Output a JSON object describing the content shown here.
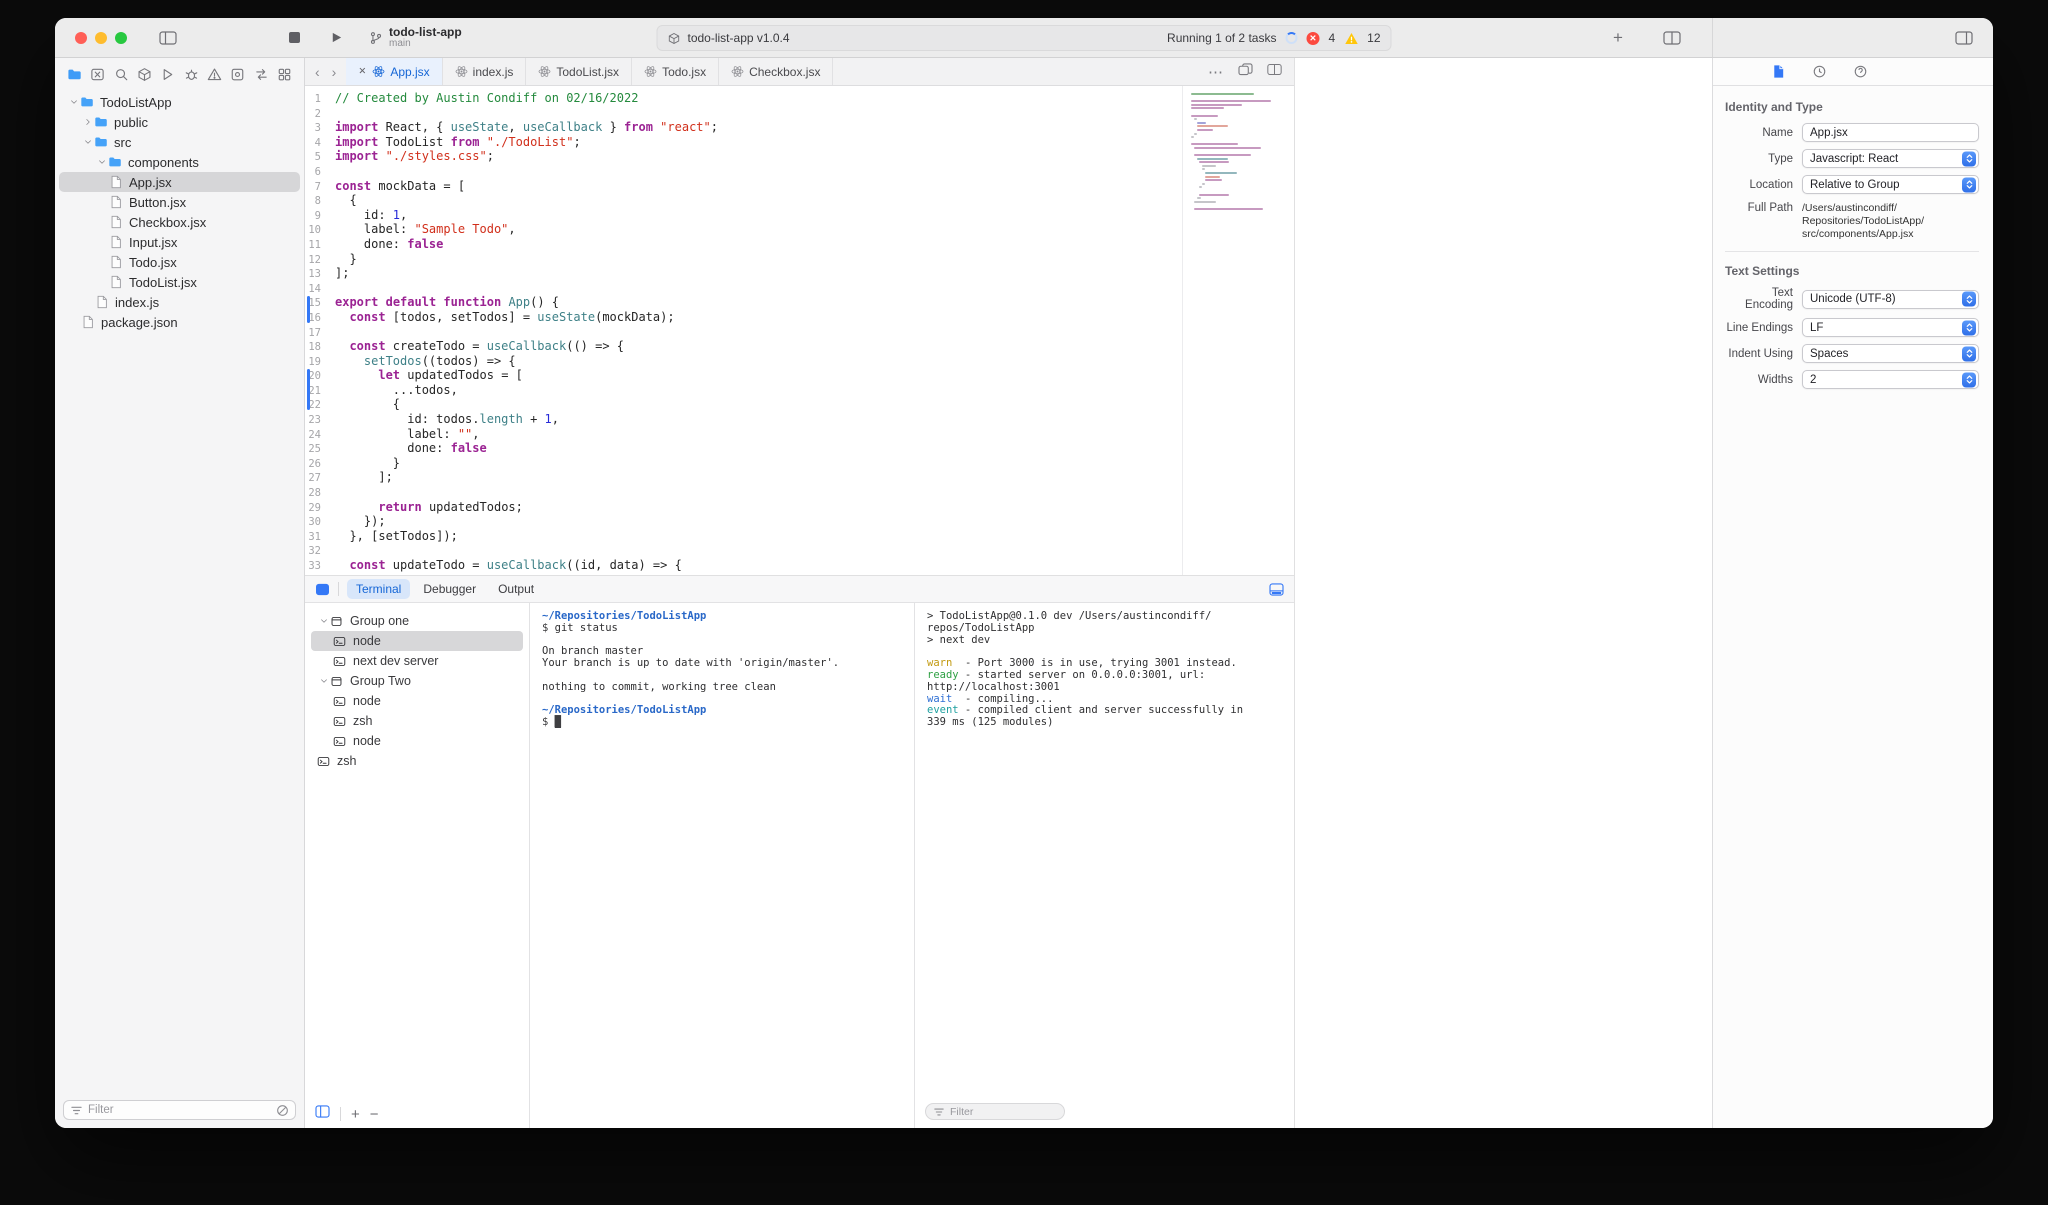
{
  "colors": {
    "accent": "#3478F6",
    "error": "#FF3B30",
    "warning": "#FFC60A",
    "syntax": {
      "comment": "#248A3D",
      "keyword": "#9B2393",
      "string": "#D12F1B",
      "number": "#272AD8",
      "function": "#3E8087",
      "plain": "#262626"
    },
    "terminal": {
      "path": "#2968C8",
      "warn": "#C29A10",
      "ready": "#2EA043",
      "wait": "#2E6FD4",
      "event": "#1FA0A0"
    }
  },
  "toolbar": {
    "project_name": "todo-list-app",
    "branch": "main",
    "status": {
      "package_label": "todo-list-app v1.0.4",
      "running_label": "Running 1 of 2 tasks",
      "errors": "4",
      "warnings": "12"
    }
  },
  "sidebar": {
    "active_nav_index": 0,
    "nav_icons": [
      "project-navigator",
      "version-control-navigator",
      "find-navigator",
      "package-navigator",
      "run-navigator",
      "debug-navigator",
      "issue-navigator",
      "test-navigator",
      "extension-navigator",
      "layout-navigator"
    ],
    "tree": [
      {
        "label": "TodoListApp",
        "level": 0,
        "type": "folder",
        "expanded": true
      },
      {
        "label": "public",
        "level": 1,
        "type": "folder",
        "expanded": false
      },
      {
        "label": "src",
        "level": 1,
        "type": "folder",
        "expanded": true
      },
      {
        "label": "components",
        "level": 2,
        "type": "folder",
        "expanded": true
      },
      {
        "label": "App.jsx",
        "level": 3,
        "type": "file",
        "selected": true
      },
      {
        "label": "Button.jsx",
        "level": 3,
        "type": "file"
      },
      {
        "label": "Checkbox.jsx",
        "level": 3,
        "type": "file"
      },
      {
        "label": "Input.jsx",
        "level": 3,
        "type": "file"
      },
      {
        "label": "Todo.jsx",
        "level": 3,
        "type": "file"
      },
      {
        "label": "TodoList.jsx",
        "level": 3,
        "type": "file"
      },
      {
        "label": "index.js",
        "level": 2,
        "type": "file"
      },
      {
        "label": "package.json",
        "level": 1,
        "type": "file"
      }
    ],
    "filter_placeholder": "Filter"
  },
  "tabs": {
    "items": [
      {
        "label": "App.jsx",
        "active": true
      },
      {
        "label": "index.js"
      },
      {
        "label": "TodoList.jsx"
      },
      {
        "label": "Todo.jsx"
      },
      {
        "label": "Checkbox.jsx"
      }
    ]
  },
  "editor": {
    "change_bars": [
      {
        "start": 15,
        "end": 16
      },
      {
        "start": 20,
        "end": 22
      }
    ],
    "lines": [
      [
        [
          "c",
          "// Created by Austin Condiff on 02/16/2022"
        ]
      ],
      [],
      [
        [
          "k",
          "import"
        ],
        [
          "p",
          " React, { "
        ],
        [
          "f",
          "useState"
        ],
        [
          "p",
          ", "
        ],
        [
          "f",
          "useCallback"
        ],
        [
          "p",
          " } "
        ],
        [
          "k",
          "from"
        ],
        [
          "p",
          " "
        ],
        [
          "s",
          "\"react\""
        ],
        [
          "p",
          ";"
        ]
      ],
      [
        [
          "k",
          "import"
        ],
        [
          "p",
          " TodoList "
        ],
        [
          "k",
          "from"
        ],
        [
          "p",
          " "
        ],
        [
          "s",
          "\"./TodoList\""
        ],
        [
          "p",
          ";"
        ]
      ],
      [
        [
          "k",
          "import"
        ],
        [
          "p",
          " "
        ],
        [
          "s",
          "\"./styles.css\""
        ],
        [
          "p",
          ";"
        ]
      ],
      [],
      [
        [
          "k",
          "const"
        ],
        [
          "p",
          " mockData = ["
        ]
      ],
      [
        [
          "p",
          "  {"
        ]
      ],
      [
        [
          "p",
          "    id: "
        ],
        [
          "n",
          "1"
        ],
        [
          "p",
          ","
        ]
      ],
      [
        [
          "p",
          "    label: "
        ],
        [
          "s",
          "\"Sample Todo\""
        ],
        [
          "p",
          ","
        ]
      ],
      [
        [
          "p",
          "    done: "
        ],
        [
          "k",
          "false"
        ]
      ],
      [
        [
          "p",
          "  }"
        ]
      ],
      [
        [
          "p",
          "];"
        ]
      ],
      [],
      [
        [
          "k",
          "export"
        ],
        [
          "p",
          " "
        ],
        [
          "k",
          "default"
        ],
        [
          "p",
          " "
        ],
        [
          "k",
          "function"
        ],
        [
          "p",
          " "
        ],
        [
          "f",
          "App"
        ],
        [
          "p",
          "() {"
        ]
      ],
      [
        [
          "p",
          "  "
        ],
        [
          "k",
          "const"
        ],
        [
          "p",
          " [todos, setTodos] = "
        ],
        [
          "f",
          "useState"
        ],
        [
          "p",
          "(mockData);"
        ]
      ],
      [],
      [
        [
          "p",
          "  "
        ],
        [
          "k",
          "const"
        ],
        [
          "p",
          " createTodo = "
        ],
        [
          "f",
          "useCallback"
        ],
        [
          "p",
          "(() => {"
        ]
      ],
      [
        [
          "p",
          "    "
        ],
        [
          "f",
          "setTodos"
        ],
        [
          "p",
          "((todos) => {"
        ]
      ],
      [
        [
          "p",
          "      "
        ],
        [
          "k",
          "let"
        ],
        [
          "p",
          " updatedTodos = ["
        ]
      ],
      [
        [
          "p",
          "        ...todos,"
        ]
      ],
      [
        [
          "p",
          "        {"
        ]
      ],
      [
        [
          "p",
          "          id: todos."
        ],
        [
          "f",
          "length"
        ],
        [
          "p",
          " + "
        ],
        [
          "n",
          "1"
        ],
        [
          "p",
          ","
        ]
      ],
      [
        [
          "p",
          "          label: "
        ],
        [
          "s",
          "\"\""
        ],
        [
          "p",
          ","
        ]
      ],
      [
        [
          "p",
          "          done: "
        ],
        [
          "k",
          "false"
        ]
      ],
      [
        [
          "p",
          "        }"
        ]
      ],
      [
        [
          "p",
          "      ];"
        ]
      ],
      [],
      [
        [
          "p",
          "      "
        ],
        [
          "k",
          "return"
        ],
        [
          "p",
          " updatedTodos;"
        ]
      ],
      [
        [
          "p",
          "    });"
        ]
      ],
      [
        [
          "p",
          "  }, [setTodos]);"
        ]
      ],
      [],
      [
        [
          "p",
          "  "
        ],
        [
          "k",
          "const"
        ],
        [
          "p",
          " updateTodo = "
        ],
        [
          "f",
          "useCallback"
        ],
        [
          "p",
          "((id, data) => {"
        ]
      ]
    ]
  },
  "inspector": {
    "sections": [
      {
        "title": "Identity and Type",
        "rows": [
          {
            "label": "Name",
            "type": "input",
            "value": "App.jsx"
          },
          {
            "label": "Type",
            "type": "select",
            "value": "Javascript: React"
          },
          {
            "label": "Location",
            "type": "select",
            "value": "Relative to Group"
          },
          {
            "label": "Full Path",
            "type": "text",
            "value": "/Users/austincondiff/\nRepositories/TodoListApp/\nsrc/components/App.jsx"
          }
        ]
      },
      {
        "title": "Text Settings",
        "rows": [
          {
            "label": "Text Encoding",
            "type": "select",
            "value": "Unicode (UTF-8)"
          },
          {
            "label": "Line Endings",
            "type": "select",
            "value": "LF"
          },
          {
            "label": "Indent Using",
            "type": "select",
            "value": "Spaces"
          },
          {
            "label": "Widths",
            "type": "stepper",
            "value": "2"
          }
        ]
      }
    ]
  },
  "drawer": {
    "tabs": [
      {
        "label": "Terminal",
        "active": true
      },
      {
        "label": "Debugger"
      },
      {
        "label": "Output"
      }
    ],
    "tree": [
      {
        "label": "Group one",
        "level": 0,
        "type": "group"
      },
      {
        "label": "node",
        "level": 1,
        "type": "terminal",
        "selected": true
      },
      {
        "label": "next dev server",
        "level": 1,
        "type": "terminal"
      },
      {
        "label": "Group Two",
        "level": 0,
        "type": "group"
      },
      {
        "label": "node",
        "level": 1,
        "type": "terminal"
      },
      {
        "label": "zsh",
        "level": 1,
        "type": "terminal"
      },
      {
        "label": "node",
        "level": 1,
        "type": "terminal"
      },
      {
        "label": "zsh",
        "level": 0,
        "type": "terminal"
      }
    ],
    "terminal1": {
      "lines": [
        [
          [
            "path",
            "~/Repositories/TodoListApp"
          ]
        ],
        [
          [
            "pr",
            "$"
          ],
          [
            "pl",
            " git status"
          ]
        ],
        [],
        [
          [
            "pl",
            "On branch master"
          ]
        ],
        [
          [
            "pl",
            "Your branch is up to date with 'origin/master'."
          ]
        ],
        [],
        [
          [
            "pl",
            "nothing to commit, working tree clean"
          ]
        ],
        [],
        [
          [
            "path",
            "~/Repositories/TodoListApp"
          ]
        ],
        [
          [
            "pr",
            "$ "
          ],
          [
            "cur",
            "█"
          ]
        ]
      ]
    },
    "terminal2": {
      "lines": [
        [
          [
            "pl",
            "> TodoListApp@0.1.0 dev /Users/austincondiff/"
          ]
        ],
        [
          [
            "pl",
            "repos/TodoListApp"
          ]
        ],
        [
          [
            "pl",
            "> next dev"
          ]
        ],
        [],
        [
          [
            "warn",
            "warn"
          ],
          [
            "pl",
            "  - Port 3000 is in use, trying 3001 instead."
          ]
        ],
        [
          [
            "ready",
            "ready"
          ],
          [
            "pl",
            " - started server on 0.0.0.0:3001, url:"
          ]
        ],
        [
          [
            "pl",
            "http://localhost:3001"
          ]
        ],
        [
          [
            "wait",
            "wait"
          ],
          [
            "pl",
            "  - compiling..."
          ]
        ],
        [
          [
            "event",
            "event"
          ],
          [
            "pl",
            " - compiled client and server successfully in"
          ]
        ],
        [
          [
            "pl",
            "339 ms (125 modules)"
          ]
        ]
      ]
    },
    "filter_placeholder": "Filter"
  }
}
